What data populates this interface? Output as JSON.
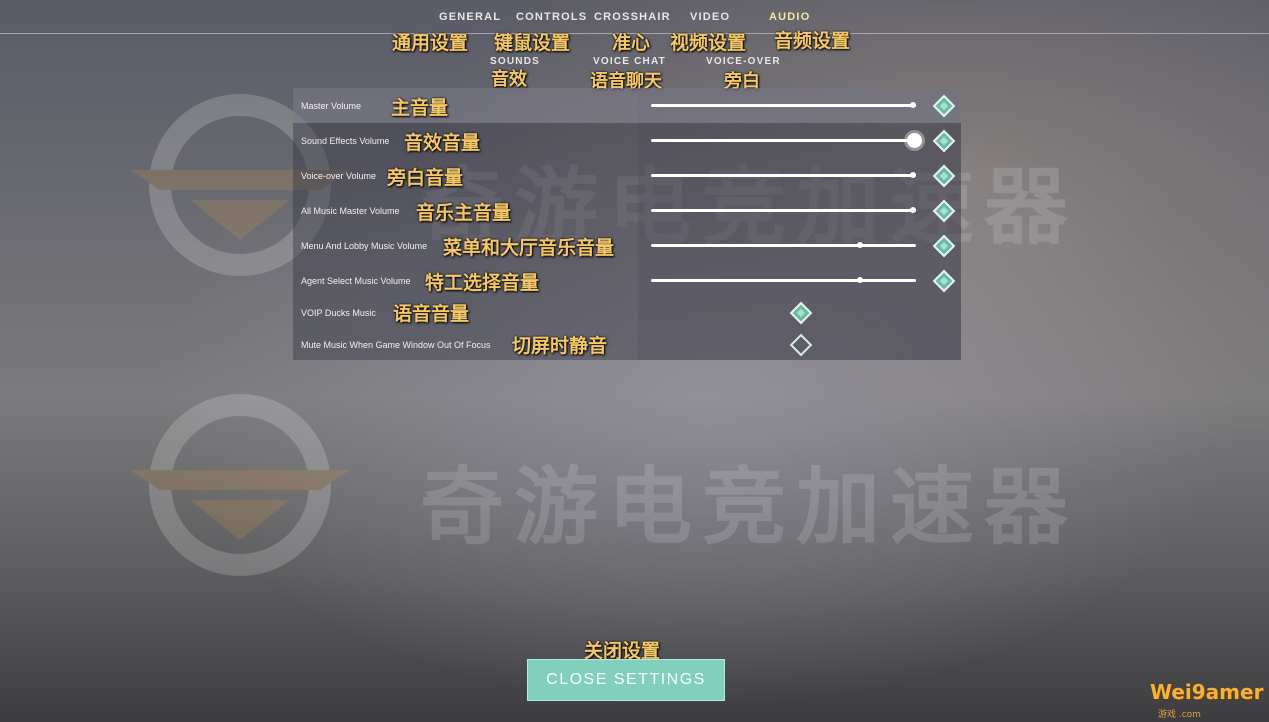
{
  "tabs": [
    {
      "label": "GENERAL",
      "cn": "通用设置"
    },
    {
      "label": "CONTROLS",
      "cn": "键鼠设置"
    },
    {
      "label": "CROSSHAIR",
      "cn": "准心"
    },
    {
      "label": "VIDEO",
      "cn": "视频设置"
    },
    {
      "label": "AUDIO",
      "cn": "音频设置"
    }
  ],
  "subtabs": [
    {
      "label": "SOUNDS",
      "cn": "音效"
    },
    {
      "label": "VOICE CHAT",
      "cn": "语音聊天"
    },
    {
      "label": "VOICE-OVER",
      "cn": "旁白"
    }
  ],
  "settings": [
    {
      "label": "Master Volume",
      "cn": "主音量",
      "type": "slider",
      "value": 1.0,
      "enabled": true
    },
    {
      "label": "Sound Effects Volume",
      "cn": "音效音量",
      "type": "slider",
      "value": 1.0,
      "enabled": true
    },
    {
      "label": "Voice-over Volume",
      "cn": "旁白音量",
      "type": "slider",
      "value": 1.0,
      "enabled": true
    },
    {
      "label": "All Music Master Volume",
      "cn": "音乐主音量",
      "type": "slider",
      "value": 1.0,
      "enabled": true
    },
    {
      "label": "Menu And Lobby Music Volume",
      "cn": "菜单和大厅音乐音量",
      "type": "slider",
      "value": 0.8,
      "enabled": true
    },
    {
      "label": "Agent Select Music Volume",
      "cn": "特工选择音量",
      "type": "slider",
      "value": 0.8,
      "enabled": true
    },
    {
      "label": "VOIP Ducks Music",
      "cn": "语音音量",
      "type": "checkbox",
      "checked": true
    },
    {
      "label": "Mute Music When Game Window Out Of Focus",
      "cn": "切屏时静音",
      "type": "checkbox",
      "checked": false
    }
  ],
  "watermark": {
    "text": "奇游电竞加速器"
  },
  "close": {
    "cn": "关闭设置",
    "label": "CLOSE SETTINGS"
  },
  "site": {
    "logo": "Wei9amer",
    "sub": "游戏 .com"
  }
}
